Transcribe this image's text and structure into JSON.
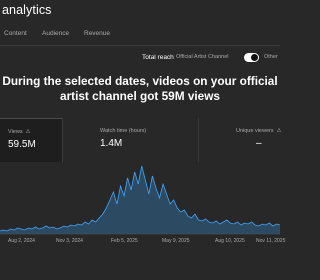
{
  "app": {
    "title": "analytics"
  },
  "tabs": [
    {
      "label": "Content"
    },
    {
      "label": "Audience"
    },
    {
      "label": "Revenue"
    }
  ],
  "filters": {
    "total_reach_label": "Total reach",
    "channel_label": "Official Artist Channel",
    "channel_toggle_on": true,
    "other_label": "Other"
  },
  "headline": "During the selected dates, videos on your official artist channel got 59M views",
  "metrics": [
    {
      "label": "Views",
      "value": "59.5M",
      "selected": true
    },
    {
      "label": "Watch time (hours)",
      "value": "1.4M",
      "selected": false
    },
    {
      "label": "Unique viewers",
      "value": "–",
      "selected": false
    }
  ],
  "chart_data": {
    "type": "area",
    "x": [
      "Aug 2, 2024",
      "Nov 3, 2024",
      "Feb 5, 2025",
      "May 9, 2025",
      "Aug 10, 2025",
      "Nov 11, 2025"
    ],
    "series": [
      {
        "values": [
          3,
          4,
          3,
          5,
          4,
          6,
          5,
          4,
          6,
          5,
          7,
          5,
          6,
          8,
          6,
          7,
          5,
          6,
          8,
          7,
          9,
          8,
          10,
          9,
          12,
          10,
          14,
          12,
          16,
          20,
          26,
          34,
          42,
          30,
          48,
          38,
          56,
          44,
          62,
          50,
          68,
          54,
          40,
          58,
          46,
          36,
          50,
          40,
          30,
          34,
          26,
          22,
          24,
          18,
          16,
          20,
          14,
          13,
          15,
          12,
          11,
          13,
          10,
          12,
          14,
          11,
          10,
          12,
          9,
          11,
          10,
          12,
          9,
          8,
          10,
          9,
          11,
          8,
          10,
          9
        ]
      }
    ],
    "color": "#3ea6ff",
    "grid": false
  }
}
